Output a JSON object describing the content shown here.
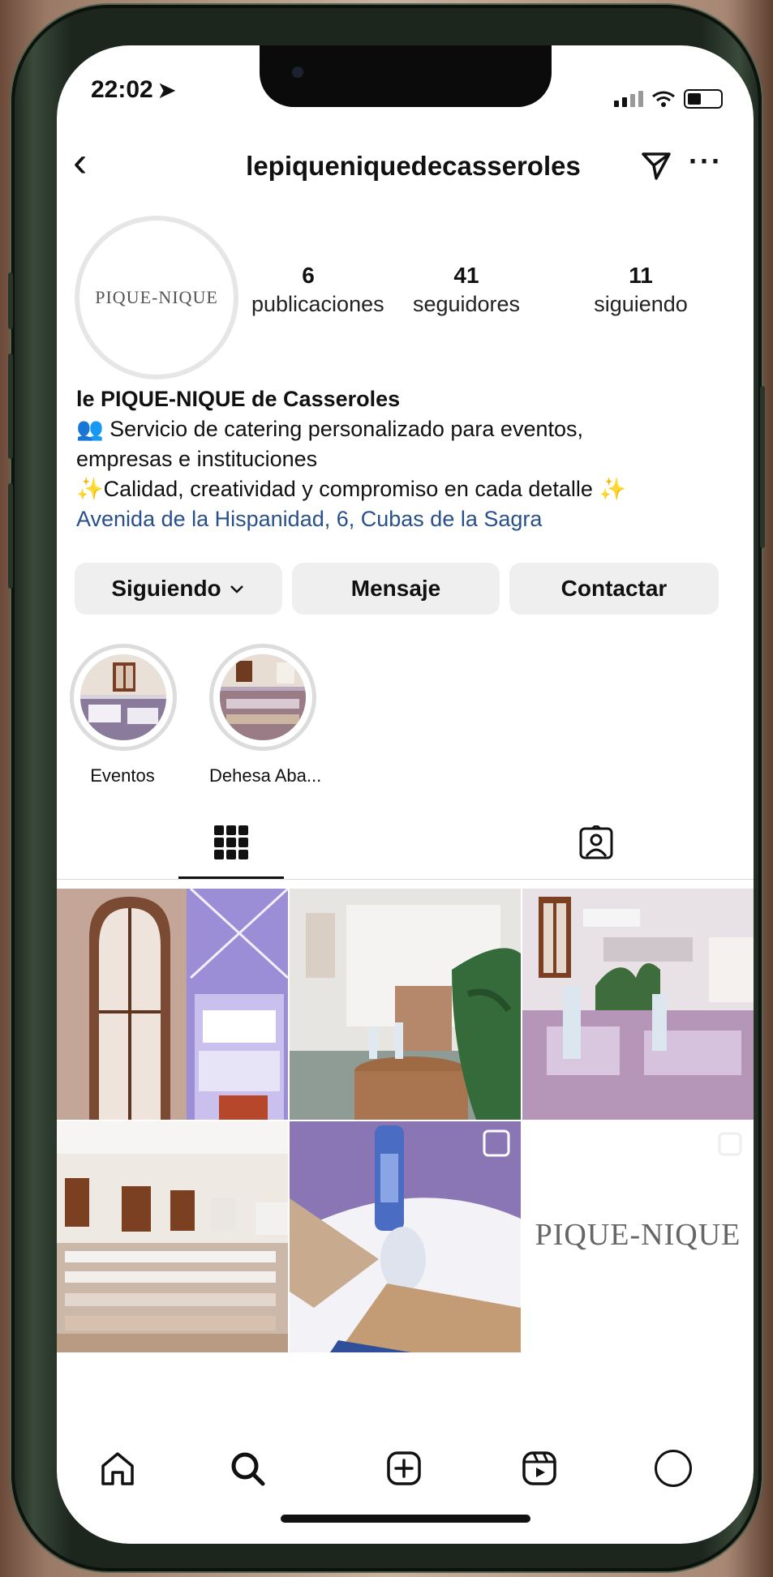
{
  "status_bar": {
    "time": "22:02"
  },
  "header": {
    "username": "lepiqueniquedecasseroles"
  },
  "profile": {
    "avatar_text": "PIQUE-NIQUE",
    "stats": [
      {
        "value": "6",
        "label": "publicaciones"
      },
      {
        "value": "41",
        "label": "seguidores"
      },
      {
        "value": "11",
        "label": "siguiendo"
      }
    ],
    "name": "le PIQUE-NIQUE de Casseroles",
    "bio_line1": "Servicio de catering personalizado para eventos,",
    "bio_line2": "empresas e instituciones",
    "bio_line3": "Calidad, creatividad y compromiso en cada detalle",
    "address": "Avenida de la Hispanidad, 6, Cubas de la Sagra"
  },
  "actions": {
    "following": "Siguiendo",
    "message": "Mensaje",
    "contact": "Contactar"
  },
  "highlights": [
    {
      "label": "Eventos"
    },
    {
      "label": "Dehesa Aba..."
    }
  ],
  "grid": {
    "logo_post_text": "PIQUE-NIQUE"
  },
  "colors": {
    "link": "#28508a",
    "button_bg": "#efefef",
    "frame": "#1c261d"
  }
}
